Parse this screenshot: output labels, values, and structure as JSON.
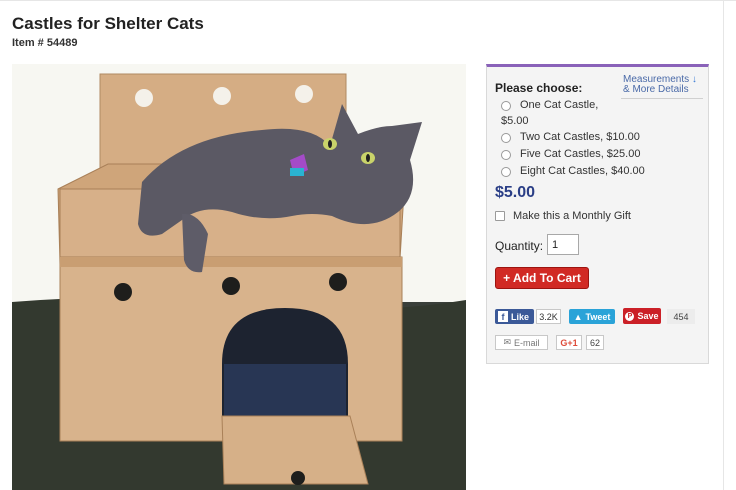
{
  "product": {
    "title": "Castles for Shelter Cats",
    "item_number": "Item # 54489",
    "image_alt": "cat lying in a cardboard castle"
  },
  "order_panel": {
    "please_choose": "Please choose:",
    "measurements_line1": "Measurements",
    "measurements_line2": "& More Details",
    "options": [
      {
        "label": "One Cat Castle,",
        "sub": "$5.00"
      },
      {
        "label": "Two Cat Castles, $10.00"
      },
      {
        "label": "Five Cat Castles, $25.00"
      },
      {
        "label": "Eight Cat Castles, $40.00"
      }
    ],
    "price": "$5.00",
    "monthly_gift": "Make this a Monthly Gift",
    "quantity_label": "Quantity:",
    "quantity_value": "1",
    "add_to_cart": "+ Add To Cart"
  },
  "social": {
    "facebook_label": "Like",
    "facebook_count": "3.2K",
    "tweet_label": "Tweet",
    "pinterest_label": "Save",
    "pinterest_count": "454",
    "email_label": "E-mail",
    "gplus_label": "G+1",
    "gplus_count": "62"
  },
  "colors": {
    "panel_accent": "#8a62b9",
    "price": "#2a3e86",
    "cart_button": "#d12a24",
    "facebook": "#3b5998",
    "twitter": "#2aa3d8",
    "pinterest": "#cb2027"
  }
}
